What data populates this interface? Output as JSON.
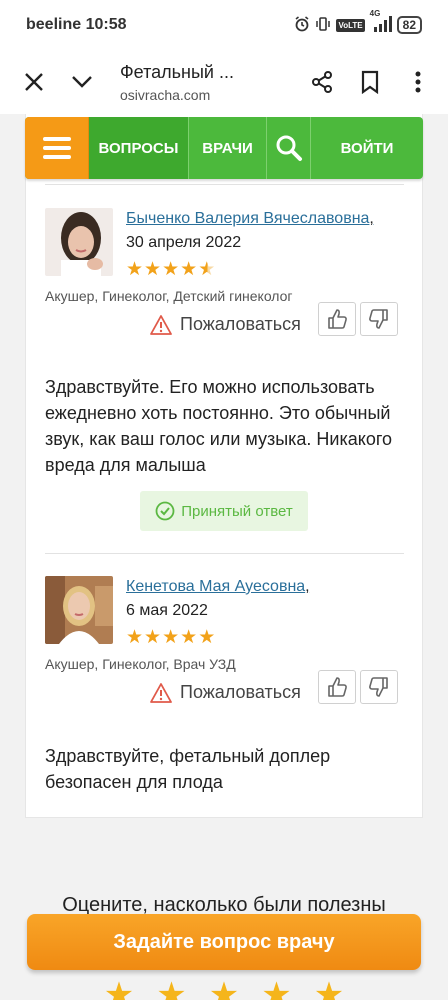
{
  "status_bar": {
    "carrier_time": "beeline 10:58",
    "battery": "82",
    "volte": "VoLTE",
    "network": "4G"
  },
  "browser": {
    "title": "Фетальный ...",
    "url": "osivracha.com",
    "icons": [
      "close-icon",
      "chevron-down-icon",
      "share-icon",
      "bookmark-icon",
      "more-vert-icon"
    ]
  },
  "nav": {
    "questions": "ВОПРОСЫ",
    "doctors": "ВРАЧИ",
    "login": "ВОЙТИ"
  },
  "answers": [
    {
      "doctor": "Быченко Валерия Вячеславовна",
      "comma": ",",
      "date": "30 апреля 2022",
      "rating": 4.5,
      "specialties": "Акушер, Гинеколог, Детский гинеколог",
      "report": "Пожаловаться",
      "text": "Здравствуйте. Его можно использовать ежедневно хоть постоянно. Это обычный звук, как ваш голос или музыка. Никакого вреда для малыша",
      "accepted_label": "Принятый ответ"
    },
    {
      "doctor": "Кенетова Мая Ауесовна",
      "comma": ",",
      "date": "6 мая 2022",
      "rating": 5,
      "specialties": "Акушер, Гинеколог, Врач УЗД",
      "report": "Пожаловаться",
      "text": "Здравствуйте, фетальный доплер безопасен для плода"
    }
  ],
  "rate_prompt": "Оцените, насколько были полезны",
  "cta_label": "Задайте вопрос врачу",
  "colors": {
    "nav_green": "#4cb93c",
    "menu_orange": "#f59a16",
    "link_blue": "#2a6f9a",
    "star": "#f2a21a",
    "accepted_green": "#5bb842",
    "cta_orange": "#f29516"
  }
}
